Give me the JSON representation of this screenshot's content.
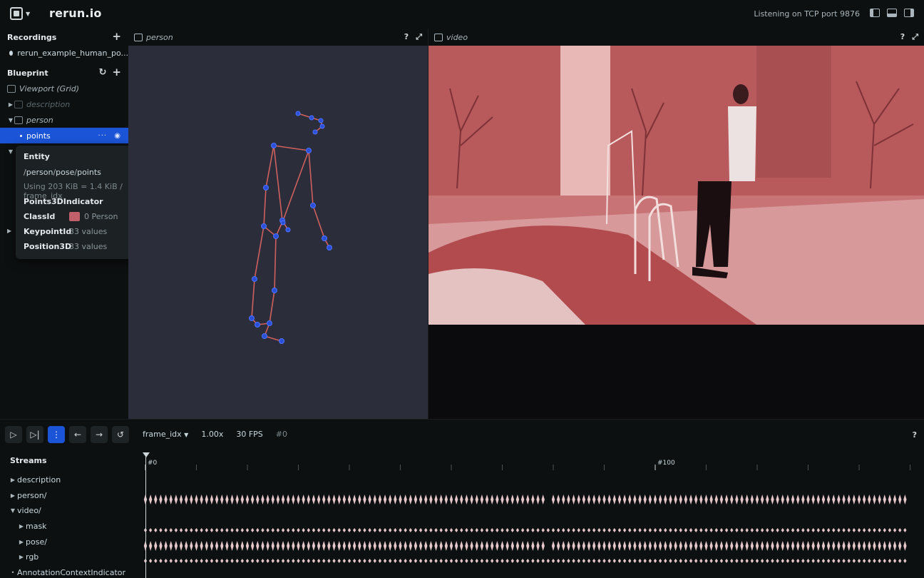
{
  "app": {
    "title": "rerun.io",
    "status": "Listening on TCP port 9876"
  },
  "left_panel": {
    "recordings": {
      "header": "Recordings",
      "items": [
        {
          "label": "rerun_example_human_po..."
        }
      ]
    },
    "blueprint": {
      "header": "Blueprint",
      "rows": [
        {
          "label": "Viewport (Grid)"
        },
        {
          "label": "description"
        },
        {
          "label": "person"
        },
        {
          "label": "points"
        }
      ]
    }
  },
  "tooltip": {
    "title": "Entity",
    "path_segments": [
      "person",
      "pose",
      "points"
    ],
    "usage": "Using 203 KiB = 1.4 KiB / frame_idx",
    "indicator": "Points3DIndicator",
    "components": [
      {
        "key": "ClassId",
        "value": "0  Person",
        "color": "#c0606a"
      },
      {
        "key": "KeypointId",
        "value": "33 values"
      },
      {
        "key": "Position3D",
        "value": "33 values"
      }
    ]
  },
  "views": {
    "person": {
      "label": "person",
      "help": "?"
    },
    "video": {
      "label": "video",
      "help": "?"
    }
  },
  "timeline": {
    "timeline_name": "frame_idx",
    "speed": "1.00x",
    "fps": "30 FPS",
    "current_frame": "#0",
    "help": "?",
    "streams_header": "Streams",
    "ruler_labels": [
      "#0",
      "#100"
    ],
    "streams": [
      {
        "label": "description",
        "expanded": false,
        "indent": 0
      },
      {
        "label": "person/",
        "expanded": false,
        "indent": 0
      },
      {
        "label": "video/",
        "expanded": true,
        "indent": 0
      },
      {
        "label": "mask",
        "expanded": false,
        "indent": 1
      },
      {
        "label": "pose/",
        "expanded": false,
        "indent": 1
      },
      {
        "label": "rgb",
        "expanded": false,
        "indent": 1
      },
      {
        "label": "AnnotationContextIndicator",
        "expanded": null,
        "indent": 0
      }
    ]
  },
  "colors": {
    "accent": "#1b54d6",
    "skeleton_line": "#d0605e",
    "keypoint": "#2a4fd8",
    "video_tint": "#c76a6c"
  }
}
